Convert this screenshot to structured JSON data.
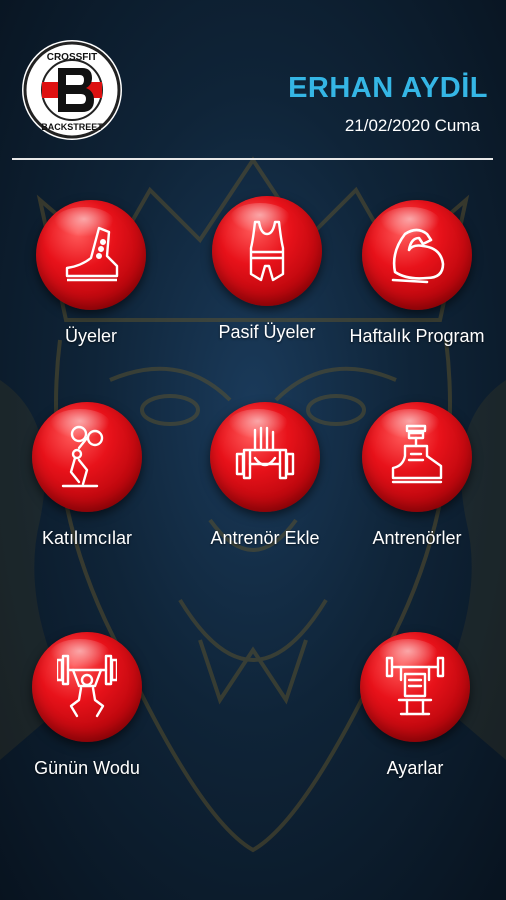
{
  "header": {
    "logo_text_top": "CROSSFIT",
    "logo_text_bottom": "BACKSTREET",
    "user_name": "ERHAN AYDİL",
    "date": "21/02/2020 Cuma"
  },
  "menu": [
    {
      "label": "Üyeler",
      "icon": "shoe-icon"
    },
    {
      "label": "Pasif Üyeler",
      "icon": "singlet-icon"
    },
    {
      "label": "Haftalık Program",
      "icon": "muscle-arm-icon"
    },
    {
      "label": "Katılımcılar",
      "icon": "lifter-icon"
    },
    {
      "label": "Antrenör Ekle",
      "icon": "dumbbell-hand-icon"
    },
    {
      "label": "Antrenörler",
      "icon": "sneaker-weight-icon"
    },
    {
      "label": "Günün Wodu",
      "icon": "squat-barbell-icon"
    },
    {
      "label": "Ayarlar",
      "icon": "bench-press-icon"
    }
  ],
  "colors": {
    "accent_blue": "#35b6e5",
    "button_red": "#e8121a"
  }
}
